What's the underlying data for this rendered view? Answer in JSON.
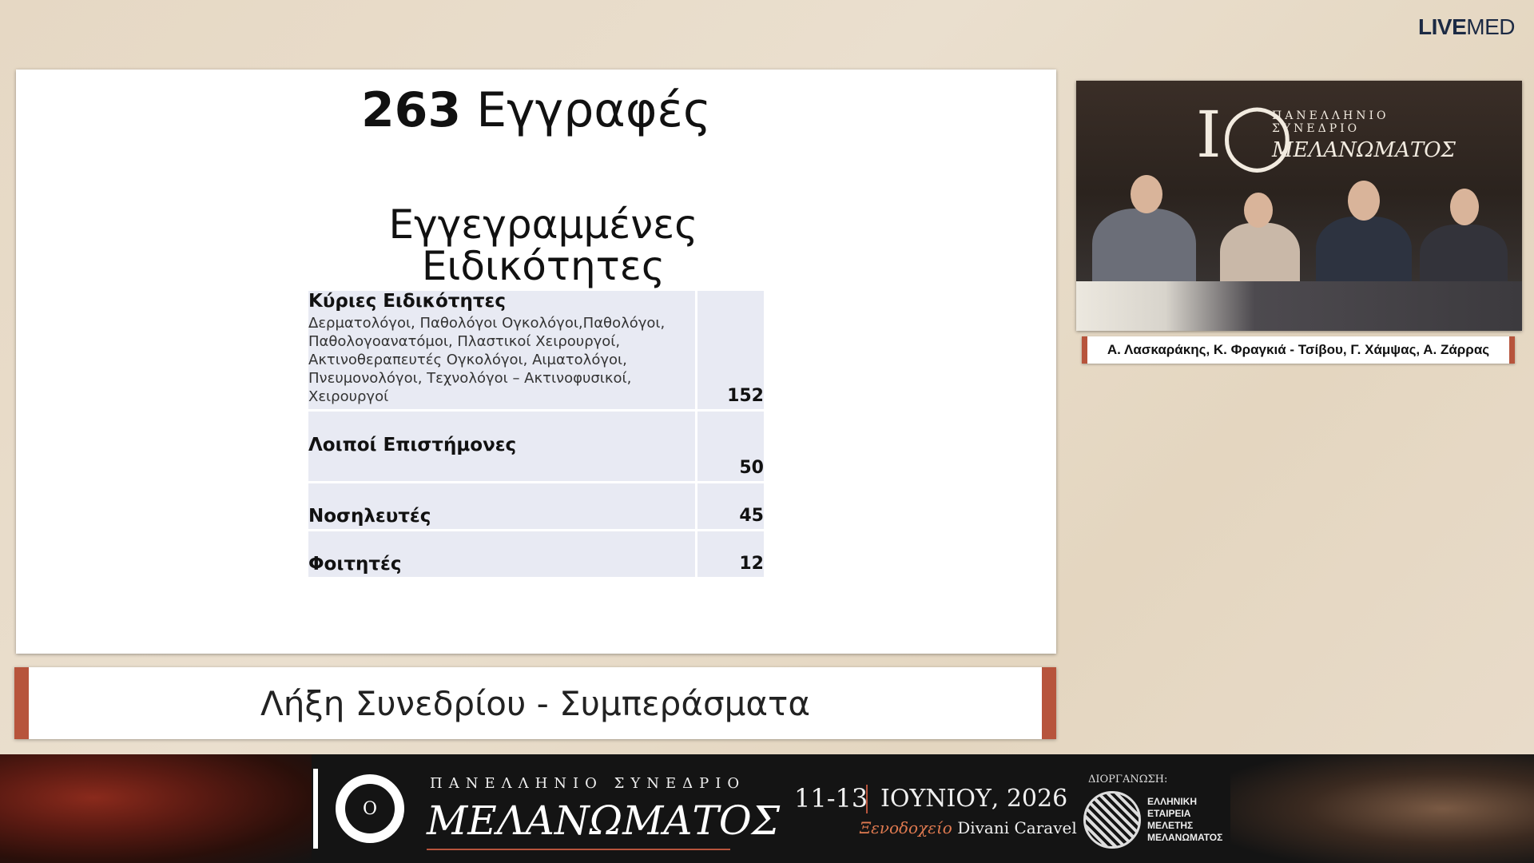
{
  "brand": {
    "live": "LIVE",
    "med": "MED"
  },
  "slide": {
    "count": "263",
    "title_rest": "Εγγραφές",
    "subtitle_line1": "Εγγεγραμμένες",
    "subtitle_line2": "Ειδικότητες",
    "rows": [
      {
        "category": "Κύριες Ειδικότητες",
        "description": "Δερματολόγοι, Παθολόγοι Ογκολόγοι,Παθολόγοι, Παθολογοανατόμοι, Πλαστικοί Χειρουργοί, Ακτινοθεραπευτές Ογκολόγοι, Αιματολόγοι, Πνευμονολόγοι, Τεχνολόγοι – Ακτινοφυσικοί, Χειρουργοί",
        "value": "152"
      },
      {
        "category": "Λοιποί Επιστήμονες",
        "description": "",
        "value": "50"
      },
      {
        "category": "Νοσηλευτές",
        "description": "",
        "value": "45"
      },
      {
        "category": "Φοιτητές",
        "description": "",
        "value": "12"
      }
    ]
  },
  "caption": "Λήξη Συνεδρίου - Συμπεράσματα",
  "video": {
    "banner_line1": "ΠΑΝΕΛΛΗΝΙΟ",
    "banner_line2": "ΣΥΝΕΔΡΙΟ",
    "banner_line3": "ΜΕΛΑΝΩΜΑΤΟΣ",
    "speakers": "Α. Λασκαράκης, Κ. Φραγκιά - Τσίβου, Γ. Χάμψας, Α. Ζάρρας"
  },
  "footer": {
    "ring_letter": "Ο",
    "line1": "ΠΑΝΕΛΛΗΝΙΟ ΣΥΝΕΔΡΙΟ",
    "line2": "ΜΕΛΑΝΩΜΑΤΟΣ",
    "dates": "11-13",
    "month_year": "ΙΟΥΝΙΟΥ, 2026",
    "venue_italic": "Ξενοδοχείο",
    "venue_name": "Divani Caravel",
    "org_label": "ΔΙΟΡΓΑΝΩΣΗ:",
    "org_name": [
      "ΕΛΛΗΝΙΚΗ",
      "ΕΤΑΙΡΕΙΑ",
      "ΜΕΛΕΤΗΣ",
      "ΜΕΛΑΝΩΜΑΤΟΣ"
    ]
  },
  "colors": {
    "accent": "#b7543c",
    "navy": "#1c2a44",
    "table_bg": "#e8eaf3"
  }
}
